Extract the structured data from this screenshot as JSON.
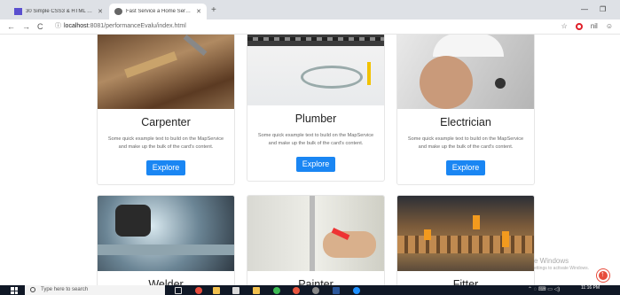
{
  "browser": {
    "tabs": [
      {
        "title": "30 Simple CSS3 & HTML Table S",
        "active": false
      },
      {
        "title": "Fast Service a Home Service Co",
        "active": true
      }
    ],
    "new_tab": "+",
    "url_prefix": "localhost",
    "url_rest": ":8081/performanceEvalu/index.html",
    "user_initials": "nil"
  },
  "cards": [
    {
      "title": "Carpenter",
      "text": "Some quick example text to build on the MapService and make up the bulk of the card's content.",
      "button": "Explore"
    },
    {
      "title": "Plumber",
      "text": "Some quick example text to build on the MapService and make up the bulk of the card's content.",
      "button": "Explore"
    },
    {
      "title": "Electrician",
      "text": "Some quick example text to build on the MapService and make up the bulk of the card's content.",
      "button": "Explore"
    },
    {
      "title": "Welder"
    },
    {
      "title": "Painter"
    },
    {
      "title": "Fitter"
    }
  ],
  "watermark": {
    "title": "e Windows",
    "subtitle": "ettings to activate Windows."
  },
  "taskbar": {
    "search_placeholder": "Type here to search",
    "time": "11:16 PM"
  },
  "colors": {
    "accent": "#1a86f3",
    "scroll_top": "#e74c3c"
  }
}
